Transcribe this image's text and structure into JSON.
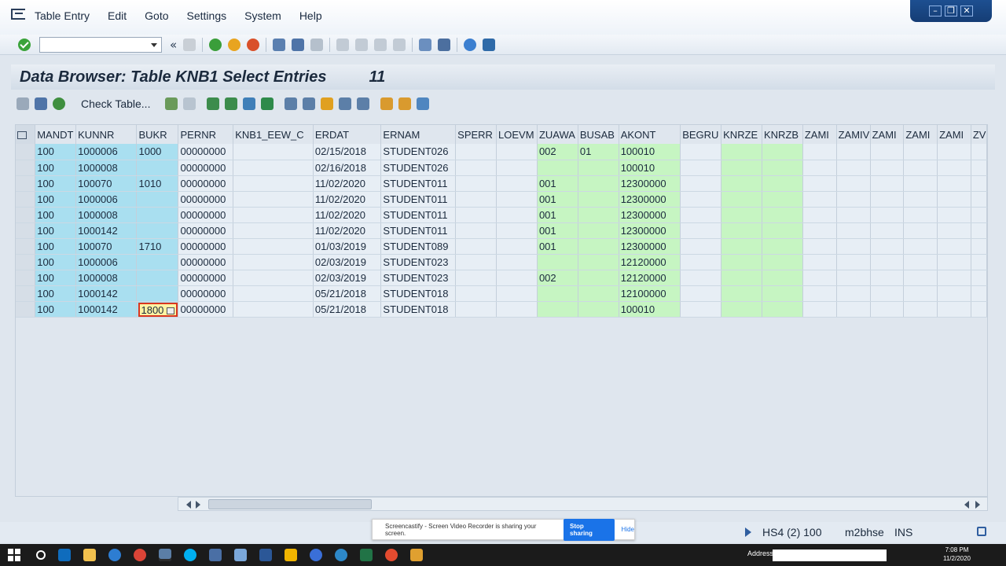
{
  "menu": [
    "Table Entry",
    "Edit",
    "Goto",
    "Settings",
    "System",
    "Help"
  ],
  "toolbar": {
    "command_value": "",
    "chevron": "«"
  },
  "header": {
    "title": "Data Browser: Table KNB1 Select Entries",
    "count": "11"
  },
  "apptool": {
    "check_table_label": "Check Table..."
  },
  "grid": {
    "columns": [
      "MANDT",
      "KUNNR",
      "BUKR",
      "PERNR",
      "KNB1_EEW_C",
      "ERDAT",
      "ERNAM",
      "SPERR",
      "LOEVM",
      "ZUAWA",
      "BUSAB",
      "AKONT",
      "BEGRU",
      "KNRZE",
      "KNRZB",
      "ZAMI",
      "ZAMIV",
      "ZAMI",
      "ZAMI",
      "ZAMI",
      "ZV"
    ],
    "rows": [
      [
        "100",
        "1000006",
        "1000",
        "00000000",
        "",
        "02/15/2018",
        "STUDENT026",
        "",
        "",
        "002",
        "01",
        "100010",
        "",
        "",
        "",
        "",
        "",
        "",
        "",
        "",
        ""
      ],
      [
        "100",
        "1000008",
        "",
        "00000000",
        "",
        "02/16/2018",
        "STUDENT026",
        "",
        "",
        "",
        "",
        "100010",
        "",
        "",
        "",
        "",
        "",
        "",
        "",
        "",
        ""
      ],
      [
        "100",
        "100070",
        "1010",
        "00000000",
        "",
        "11/02/2020",
        "STUDENT011",
        "",
        "",
        "001",
        "",
        "12300000",
        "",
        "",
        "",
        "",
        "",
        "",
        "",
        "",
        ""
      ],
      [
        "100",
        "1000006",
        "",
        "00000000",
        "",
        "11/02/2020",
        "STUDENT011",
        "",
        "",
        "001",
        "",
        "12300000",
        "",
        "",
        "",
        "",
        "",
        "",
        "",
        "",
        ""
      ],
      [
        "100",
        "1000008",
        "",
        "00000000",
        "",
        "11/02/2020",
        "STUDENT011",
        "",
        "",
        "001",
        "",
        "12300000",
        "",
        "",
        "",
        "",
        "",
        "",
        "",
        "",
        ""
      ],
      [
        "100",
        "1000142",
        "",
        "00000000",
        "",
        "11/02/2020",
        "STUDENT011",
        "",
        "",
        "001",
        "",
        "12300000",
        "",
        "",
        "",
        "",
        "",
        "",
        "",
        "",
        ""
      ],
      [
        "100",
        "100070",
        "1710",
        "00000000",
        "",
        "01/03/2019",
        "STUDENT089",
        "",
        "",
        "001",
        "",
        "12300000",
        "",
        "",
        "",
        "",
        "",
        "",
        "",
        "",
        ""
      ],
      [
        "100",
        "1000006",
        "",
        "00000000",
        "",
        "02/03/2019",
        "STUDENT023",
        "",
        "",
        "",
        "",
        "12120000",
        "",
        "",
        "",
        "",
        "",
        "",
        "",
        "",
        ""
      ],
      [
        "100",
        "1000008",
        "",
        "00000000",
        "",
        "02/03/2019",
        "STUDENT023",
        "",
        "",
        "002",
        "",
        "12120000",
        "",
        "",
        "",
        "",
        "",
        "",
        "",
        "",
        ""
      ],
      [
        "100",
        "1000142",
        "",
        "00000000",
        "",
        "05/21/2018",
        "STUDENT018",
        "",
        "",
        "",
        "",
        "12100000",
        "",
        "",
        "",
        "",
        "",
        "",
        "",
        "",
        ""
      ],
      [
        "100",
        "1000142",
        "1800",
        "00000000",
        "",
        "05/21/2018",
        "STUDENT018",
        "",
        "",
        "",
        "",
        "100010",
        "",
        "",
        "",
        "",
        "",
        "",
        "",
        "",
        ""
      ]
    ]
  },
  "status": {
    "system": "HS4 (2) 100",
    "server": "m2bhse",
    "mode": "INS"
  },
  "screencast": {
    "message": "Screencastify - Screen Video Recorder is sharing your screen.",
    "stop": "Stop sharing",
    "hide": "Hide"
  },
  "taskbar": {
    "address_label": "Address",
    "time": "7:08 PM",
    "date": "11/2/2020"
  },
  "colors": {
    "key": "#a9dff0",
    "normal": "#e7eef5",
    "green": "#c6f5c2",
    "edit": "#fff3a3"
  }
}
